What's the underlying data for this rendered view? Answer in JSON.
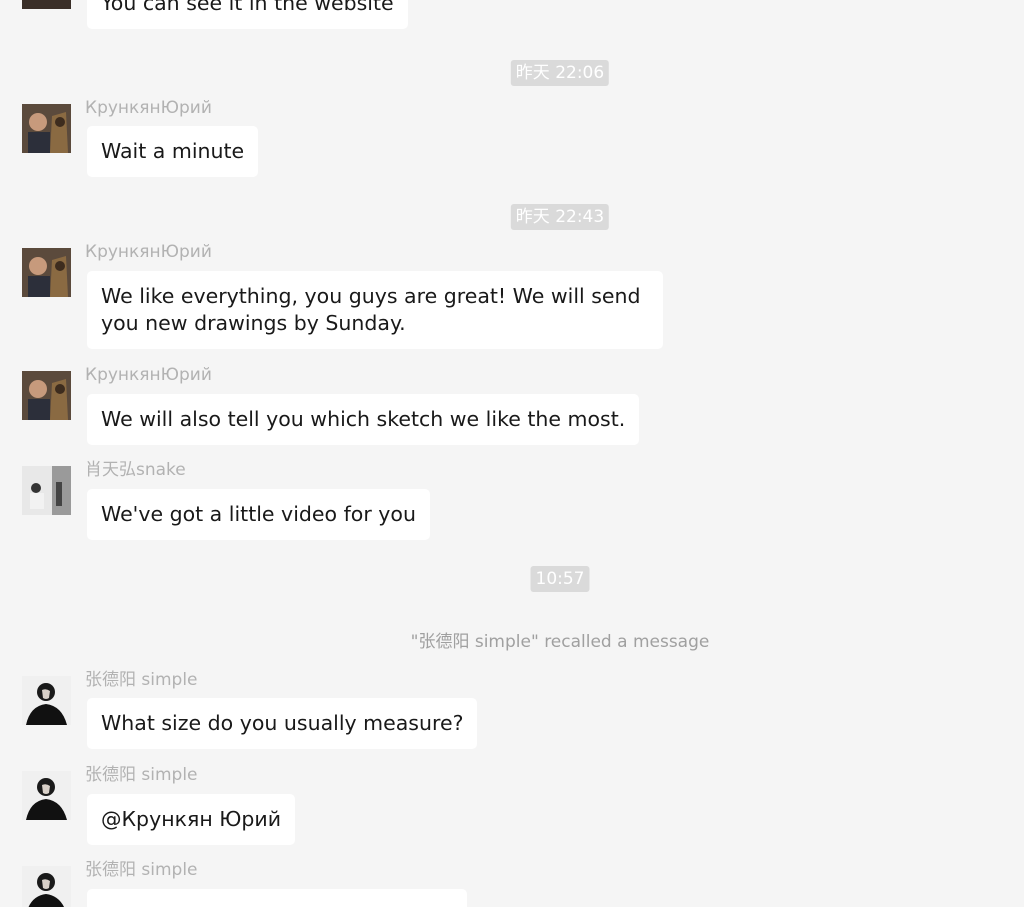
{
  "colors": {
    "background": "#f5f5f5",
    "bubble": "#ffffff",
    "time_badge": "#dadada",
    "sender_text": "#b2b2b2",
    "message_text": "#191919"
  },
  "messages": [
    {
      "text": "You can see it in the website"
    },
    {
      "time": "昨天 22:06"
    },
    {
      "sender": "КрункянЮрий",
      "text": "Wait a minute"
    },
    {
      "time": "昨天 22:43"
    },
    {
      "sender": "КрункянЮрий",
      "text": "We like everything, you guys are great! We will send you new drawings by Sunday."
    },
    {
      "sender": "КрункянЮрий",
      "text": "We will also tell you which sketch we like the most."
    },
    {
      "sender": "肖天弘snake",
      "text": "We've got a little video for you"
    },
    {
      "time": "10:57"
    },
    {
      "system": "\"张德阳 simple\" recalled a message"
    },
    {
      "sender": "张德阳 simple",
      "text": "What size do you usually measure?"
    },
    {
      "sender": "张德阳 simple",
      "text": "@Крункян Юрий"
    },
    {
      "sender": "张德阳 simple",
      "text": ""
    }
  ]
}
